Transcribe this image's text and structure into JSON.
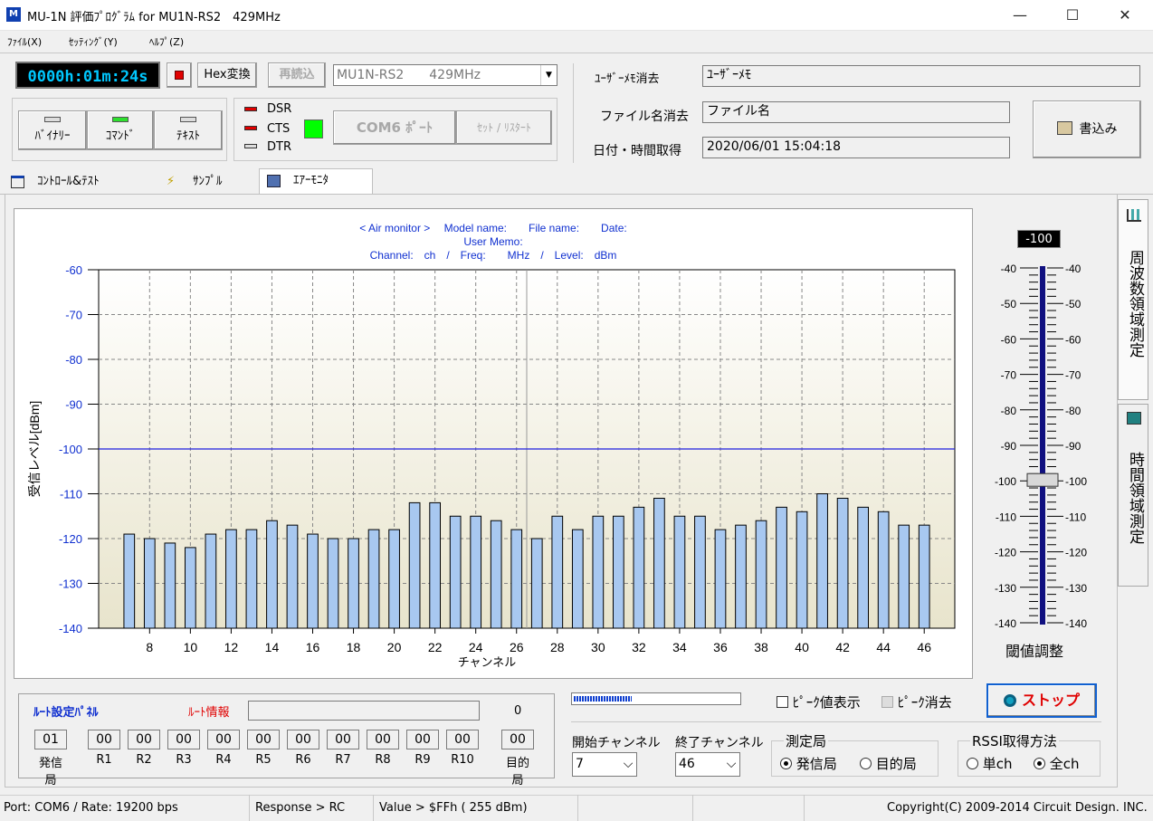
{
  "window": {
    "title": "MU-1N 評価ﾌﾟﾛｸﾞﾗﾑ for MU1N-RS2　429MHz",
    "icon_label": "M",
    "minimize": "—",
    "maximize": "☐",
    "close": "✕"
  },
  "menu": [
    "ﾌｧｲﾙ(X)",
    "ｾｯﾃｨﾝｸﾞ(Y)",
    "ﾍﾙﾌﾟ(Z)"
  ],
  "toolbar": {
    "timer": "0000h:01m:24s",
    "hex_label": "Hex変換",
    "reload_label": "再読込",
    "device_combo": "MU1N-RS2　　429MHz",
    "combo_arrow": "▼"
  },
  "mode_buttons": [
    "ﾊﾞｲﾅﾘｰ",
    "ｺﾏﾝﾄﾞ",
    "ﾃｷｽﾄ"
  ],
  "signals": {
    "dsr": "DSR",
    "cts": "CTS",
    "dtr": "DTR"
  },
  "port": {
    "com_label": "COM6 ﾎﾟｰﾄ",
    "reset_label": "ｾｯﾄ / ﾘｽﾀｰﾄ"
  },
  "info": {
    "user_memo_label": "ﾕｰｻﾞｰﾒﾓ消去",
    "user_memo_value": "ﾕｰｻﾞｰﾒﾓ",
    "file_label": "ファイル名消去",
    "file_value": "ファイル名",
    "date_label": "日付・時間取得",
    "date_value": "2020/06/01 15:04:18",
    "write_label": "書込み"
  },
  "tabs": [
    "ｺﾝﾄﾛｰﾙ&ﾃｽﾄ",
    "ｻﾝﾌﾟﾙ",
    "ｴｱｰﾓﾆﾀ"
  ],
  "side_tabs": [
    "周波数領域測定",
    "時間領域測定"
  ],
  "chart_header": {
    "line1": "< Air monitor >　 Model name:　　File name:　　Date:",
    "line2": "User Memo:",
    "line3": "Channel:　ch　/　Freq:　　MHz　/　Level:　dBm"
  },
  "chart_data": {
    "type": "bar",
    "xlabel": "チャンネル",
    "ylabel": "受信レベル[dBm]",
    "ylim": [
      -140,
      -60
    ],
    "yticks": [
      -60,
      -70,
      -80,
      -90,
      -100,
      -110,
      -120,
      -130,
      -140
    ],
    "xticks": [
      8,
      10,
      12,
      14,
      16,
      18,
      20,
      22,
      24,
      26,
      28,
      30,
      32,
      34,
      36,
      38,
      40,
      42,
      44,
      46
    ],
    "threshold": -100,
    "categories": [
      7,
      8,
      9,
      10,
      11,
      12,
      13,
      14,
      15,
      16,
      17,
      18,
      19,
      20,
      21,
      22,
      23,
      24,
      25,
      26,
      27,
      28,
      29,
      30,
      31,
      32,
      33,
      34,
      35,
      36,
      37,
      38,
      39,
      40,
      41,
      42,
      43,
      44,
      45,
      46
    ],
    "values": [
      -119,
      -120,
      -121,
      -122,
      -119,
      -118,
      -118,
      -116,
      -117,
      -119,
      -120,
      -120,
      -118,
      -118,
      -112,
      -112,
      -115,
      -115,
      -116,
      -118,
      -120,
      -115,
      -118,
      -115,
      -115,
      -113,
      -111,
      -115,
      -115,
      -118,
      -117,
      -116,
      -113,
      -114,
      -110,
      -111,
      -113,
      -114,
      -117,
      -117
    ],
    "bar_color": "#a8c8f0",
    "threshold_color": "#2020e0",
    "grid": true
  },
  "threshold": {
    "display": "-100",
    "label": "閾値調整",
    "scale": [
      -40,
      -50,
      -60,
      -70,
      -80,
      -90,
      -100,
      -110,
      -120,
      -130,
      -140
    ],
    "value": -100
  },
  "route": {
    "title": "ﾙｰﾄ設定ﾊﾟﾈﾙ",
    "info_label": "ﾙｰﾄ情報",
    "count": "0",
    "src_value": "01",
    "src_label": "発信局",
    "repeaters": [
      {
        "v": "00",
        "l": "R1"
      },
      {
        "v": "00",
        "l": "R2"
      },
      {
        "v": "00",
        "l": "R3"
      },
      {
        "v": "00",
        "l": "R4"
      },
      {
        "v": "00",
        "l": "R5"
      },
      {
        "v": "00",
        "l": "R6"
      },
      {
        "v": "00",
        "l": "R7"
      },
      {
        "v": "00",
        "l": "R8"
      },
      {
        "v": "00",
        "l": "R9"
      },
      {
        "v": "00",
        "l": "R10"
      }
    ],
    "dst_value": "00",
    "dst_label": "目的局"
  },
  "controls": {
    "peak_show": "ﾋﾟｰｸ値表示",
    "peak_clear": "ﾋﾟｰｸ消去",
    "stop": "ストップ",
    "start_ch_label": "開始チャンネル",
    "start_ch": "7",
    "end_ch_label": "終了チャンネル",
    "end_ch": "46",
    "station_label": "測定局",
    "station_src": "発信局",
    "station_dst": "目的局",
    "rssi_label": "RSSI取得方法",
    "rssi_single": "単ch",
    "rssi_all": "全ch",
    "arrow": "⌵"
  },
  "status": {
    "port": "Port: COM6 / Rate: 19200 bps",
    "response": "Response > RC",
    "value": "Value > $FFh ( 255 dBm)",
    "copyright": "Copyright(C) 2009-2014 Circuit Design. INC."
  }
}
